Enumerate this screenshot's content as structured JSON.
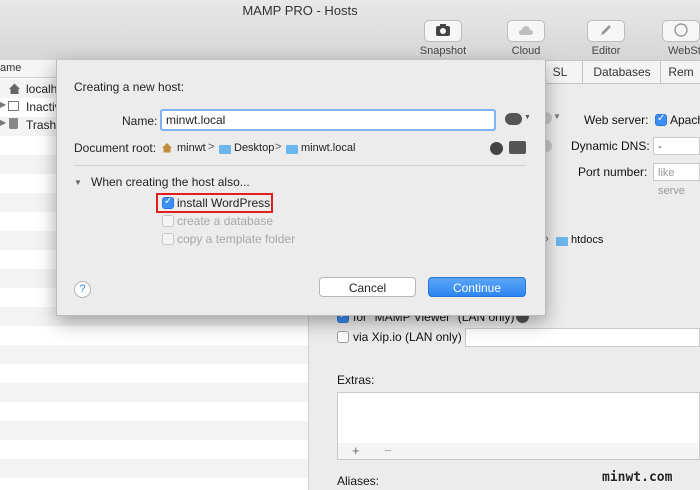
{
  "window": {
    "title": "MAMP PRO - Hosts"
  },
  "toolbar": {
    "snapshot": "Snapshot",
    "cloud": "Cloud",
    "editor": "Editor",
    "webstart": "WebSta"
  },
  "sidebar": {
    "column_header": "ame",
    "items": [
      {
        "label": "localh"
      },
      {
        "label": "Inactiv"
      },
      {
        "label": "Trash"
      }
    ]
  },
  "right_panel": {
    "tabs": [
      "SL",
      "Databases",
      "Rem"
    ],
    "web_server_label": "Web server:",
    "web_server_value": "Apach",
    "dynamic_dns_label": "Dynamic DNS:",
    "dynamic_dns_value": "-",
    "port_label": "Port number:",
    "port_placeholder": "like serve",
    "htdocs": "htdocs",
    "mamp_viewer": "for \"MAMP Viewer\" (LAN only)",
    "xip": "via Xip.io (LAN only)",
    "extras_label": "Extras:",
    "plus": "+",
    "minus": "−",
    "aliases_label": "Aliases:"
  },
  "sheet": {
    "heading": "Creating a new host:",
    "name_label": "Name:",
    "name_value": "minwt.local",
    "docroot_label": "Document root:",
    "path": [
      "minwt",
      "Desktop",
      "minwt.local"
    ],
    "sep": ">",
    "disclosure": "When creating the host also...",
    "option_wordpress": "install WordPress",
    "option_database": "create a database",
    "option_template": "copy a template folder",
    "help": "?",
    "cancel": "Cancel",
    "continue": "Continue"
  },
  "watermark": "minwt.com",
  "colors": {
    "accent": "#2c86f1",
    "highlight_border": "#e0201b"
  }
}
